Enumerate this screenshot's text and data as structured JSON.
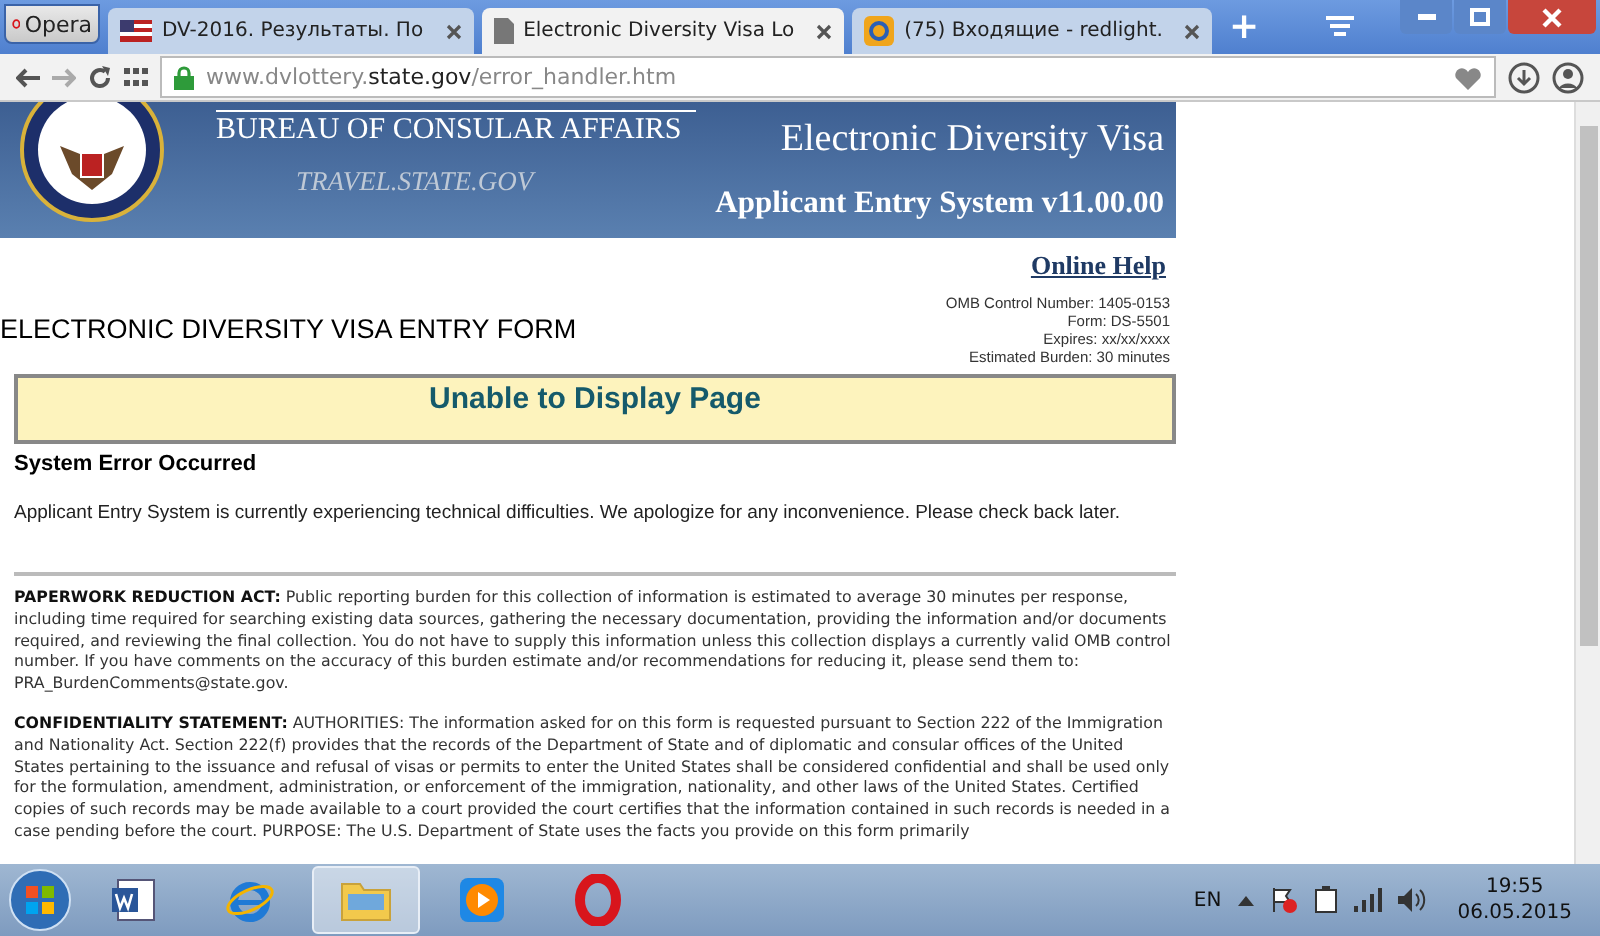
{
  "browser": {
    "menu_button": "Opera",
    "tabs": [
      {
        "title": "DV-2016. Результаты. По",
        "selected": false
      },
      {
        "title": "Electronic Diversity Visa Lo",
        "selected": true
      },
      {
        "title": "(75) Входящие - redlight.",
        "selected": false
      }
    ],
    "new_tab": "+",
    "url": "www.dvlottery.**state.gov**/error_handler.htm"
  },
  "banner": {
    "agency": "BUREAU OF CONSULAR AFFAIRS",
    "site": "TRAVEL.STATE.GOV",
    "program": "Electronic Diversity Visa",
    "system": "Applicant Entry System v11.00.00"
  },
  "help_link": "Online Help",
  "form_title": "ELECTRONIC DIVERSITY VISA ENTRY FORM",
  "omb": [
    "OMB Control Number: 1405-0153",
    "Form: DS-5501",
    "Expires: xx/xx/xxxx",
    "Estimated Burden: 30 minutes"
  ],
  "error": {
    "banner": "Unable to Display Page",
    "heading": "System Error Occurred",
    "message": "Applicant Entry System is currently experiencing technical difficulties. We apologize for any inconvenience. Please check back later."
  },
  "notices": [
    "**PAPERWORK REDUCTION ACT:** Public reporting burden for this collection of information is estimated to average 30 minutes per response, including time required for searching existing data sources, gathering the necessary documentation, providing the information and/or documents required, and reviewing the final collection. You do not have to supply this information unless this collection displays a currently valid OMB control number. If you have comments on the accuracy of this burden estimate and/or recommendations for reducing it, please send them to: PRA_BurdenComments@state.gov.",
    "**CONFIDENTIALITY STATEMENT:** AUTHORITIES: The information asked for on this form is requested pursuant to Section 222 of the Immigration and Nationality Act. Section 222(f) provides that the records of the Department of State and of diplomatic and consular offices of the United States pertaining to the issuance and refusal of visas or permits to enter the United States shall be considered confidential and shall be used only for the formulation, amendment, administration, or enforcement of the immigration, nationality, and other laws of the United States. Certified copies of such records may be made available to a court provided the court certifies that the information contained in such records is needed in a case pending before the court. PURPOSE: The U.S. Department of State uses the facts you provide on this form primarily"
  ],
  "taskbar": {
    "apps": [
      {
        "kind": "word",
        "selected": false
      },
      {
        "kind": "ie",
        "selected": false
      },
      {
        "kind": "folder",
        "selected": true
      },
      {
        "kind": "player",
        "selected": false
      },
      {
        "kind": "opera",
        "selected": false
      }
    ],
    "language": "EN",
    "time": "19:55",
    "date": "06.05.2015"
  }
}
